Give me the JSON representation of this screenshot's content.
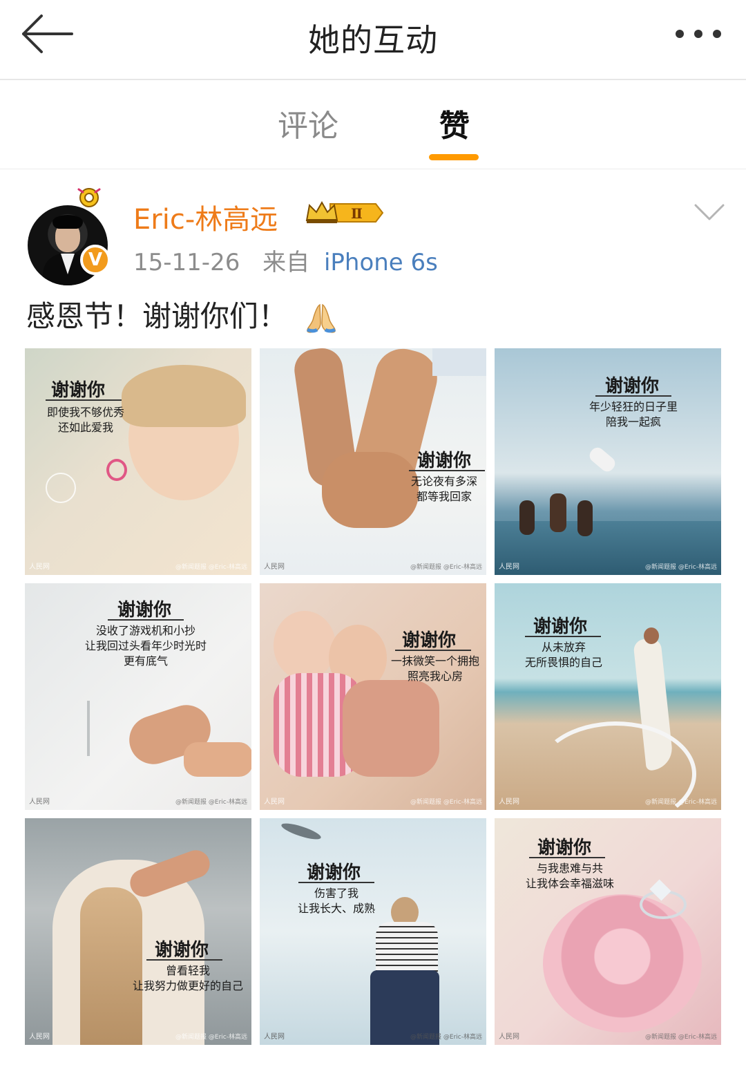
{
  "header": {
    "title": "她的互动"
  },
  "tabs": [
    {
      "label": "评论",
      "active": false
    },
    {
      "label": "赞",
      "active": true
    }
  ],
  "accent_color": "#ff9a00",
  "post": {
    "author": {
      "name": "Eric-林高远",
      "badge_level": "Ⅱ"
    },
    "date": "15-11-26",
    "source_prefix": "来自",
    "device": "iPhone 6s",
    "text": "感恩节！谢谢你们！",
    "emoji": "folded-hands",
    "images": [
      {
        "title": "谢谢你",
        "lines": [
          "即使我不够优秀",
          "还如此爱我"
        ],
        "watermark": "人民网",
        "credit": "@新闻题报  @Eric-林高远"
      },
      {
        "title": "谢谢你",
        "lines": [
          "无论夜有多深",
          "都等我回家"
        ],
        "watermark": "人民网",
        "credit": "@新闻题报  @Eric-林高远"
      },
      {
        "title": "谢谢你",
        "lines": [
          "年少轻狂的日子里",
          "陪我一起疯"
        ],
        "watermark": "人民网",
        "credit": "@新闻题报  @Eric-林高远"
      },
      {
        "title": "谢谢你",
        "lines": [
          "没收了游戏机和小抄",
          "让我回过头看年少时光时",
          "更有底气"
        ],
        "watermark": "人民网",
        "credit": "@新闻题报  @Eric-林高远"
      },
      {
        "title": "谢谢你",
        "lines": [
          "一抹微笑一个拥抱",
          "照亮我心房"
        ],
        "watermark": "人民网",
        "credit": "@新闻题报  @Eric-林高远"
      },
      {
        "title": "谢谢你",
        "lines": [
          "从未放弃",
          "无所畏惧的自己"
        ],
        "watermark": "人民网",
        "credit": "@新闻题报  @Eric-林高远"
      },
      {
        "title": "谢谢你",
        "lines": [
          "曾看轻我",
          "让我努力做更好的自己"
        ],
        "watermark": "人民网",
        "credit": "@新闻题报  @Eric-林高远"
      },
      {
        "title": "谢谢你",
        "lines": [
          "伤害了我",
          "让我长大、成熟"
        ],
        "watermark": "人民网",
        "credit": "@新闻题报  @Eric-林高远"
      },
      {
        "title": "谢谢你",
        "lines": [
          "与我患难与共",
          "让我体会幸福滋味"
        ],
        "watermark": "人民网",
        "credit": "@新闻题报  @Eric-林高远"
      }
    ]
  }
}
